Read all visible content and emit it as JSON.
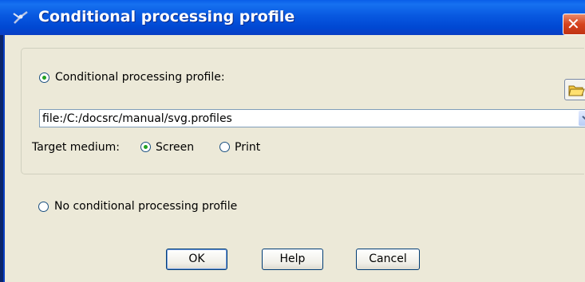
{
  "window": {
    "title": "Conditional processing profile",
    "close_glyph": "✕"
  },
  "profile_option": {
    "label": "Conditional processing profile:",
    "selected": true
  },
  "profile_path": {
    "value": "file:/C:/docsrc/manual/svg.profiles"
  },
  "target_medium": {
    "label": "Target medium:",
    "options": [
      {
        "label": "Screen",
        "selected": true
      },
      {
        "label": "Print",
        "selected": false
      }
    ]
  },
  "no_profile_option": {
    "label": "No conditional processing profile",
    "selected": false
  },
  "buttons": {
    "ok": "OK",
    "help": "Help",
    "cancel": "Cancel"
  },
  "icons": {
    "title": "app-icon",
    "browse": "folder-icon",
    "dropdown": "chevron-down-icon"
  },
  "colors": {
    "titlebar": "#0a5ee8",
    "dialog_bg": "#ece9d8",
    "radio_dot": "#21a121",
    "close": "#d6431d"
  }
}
